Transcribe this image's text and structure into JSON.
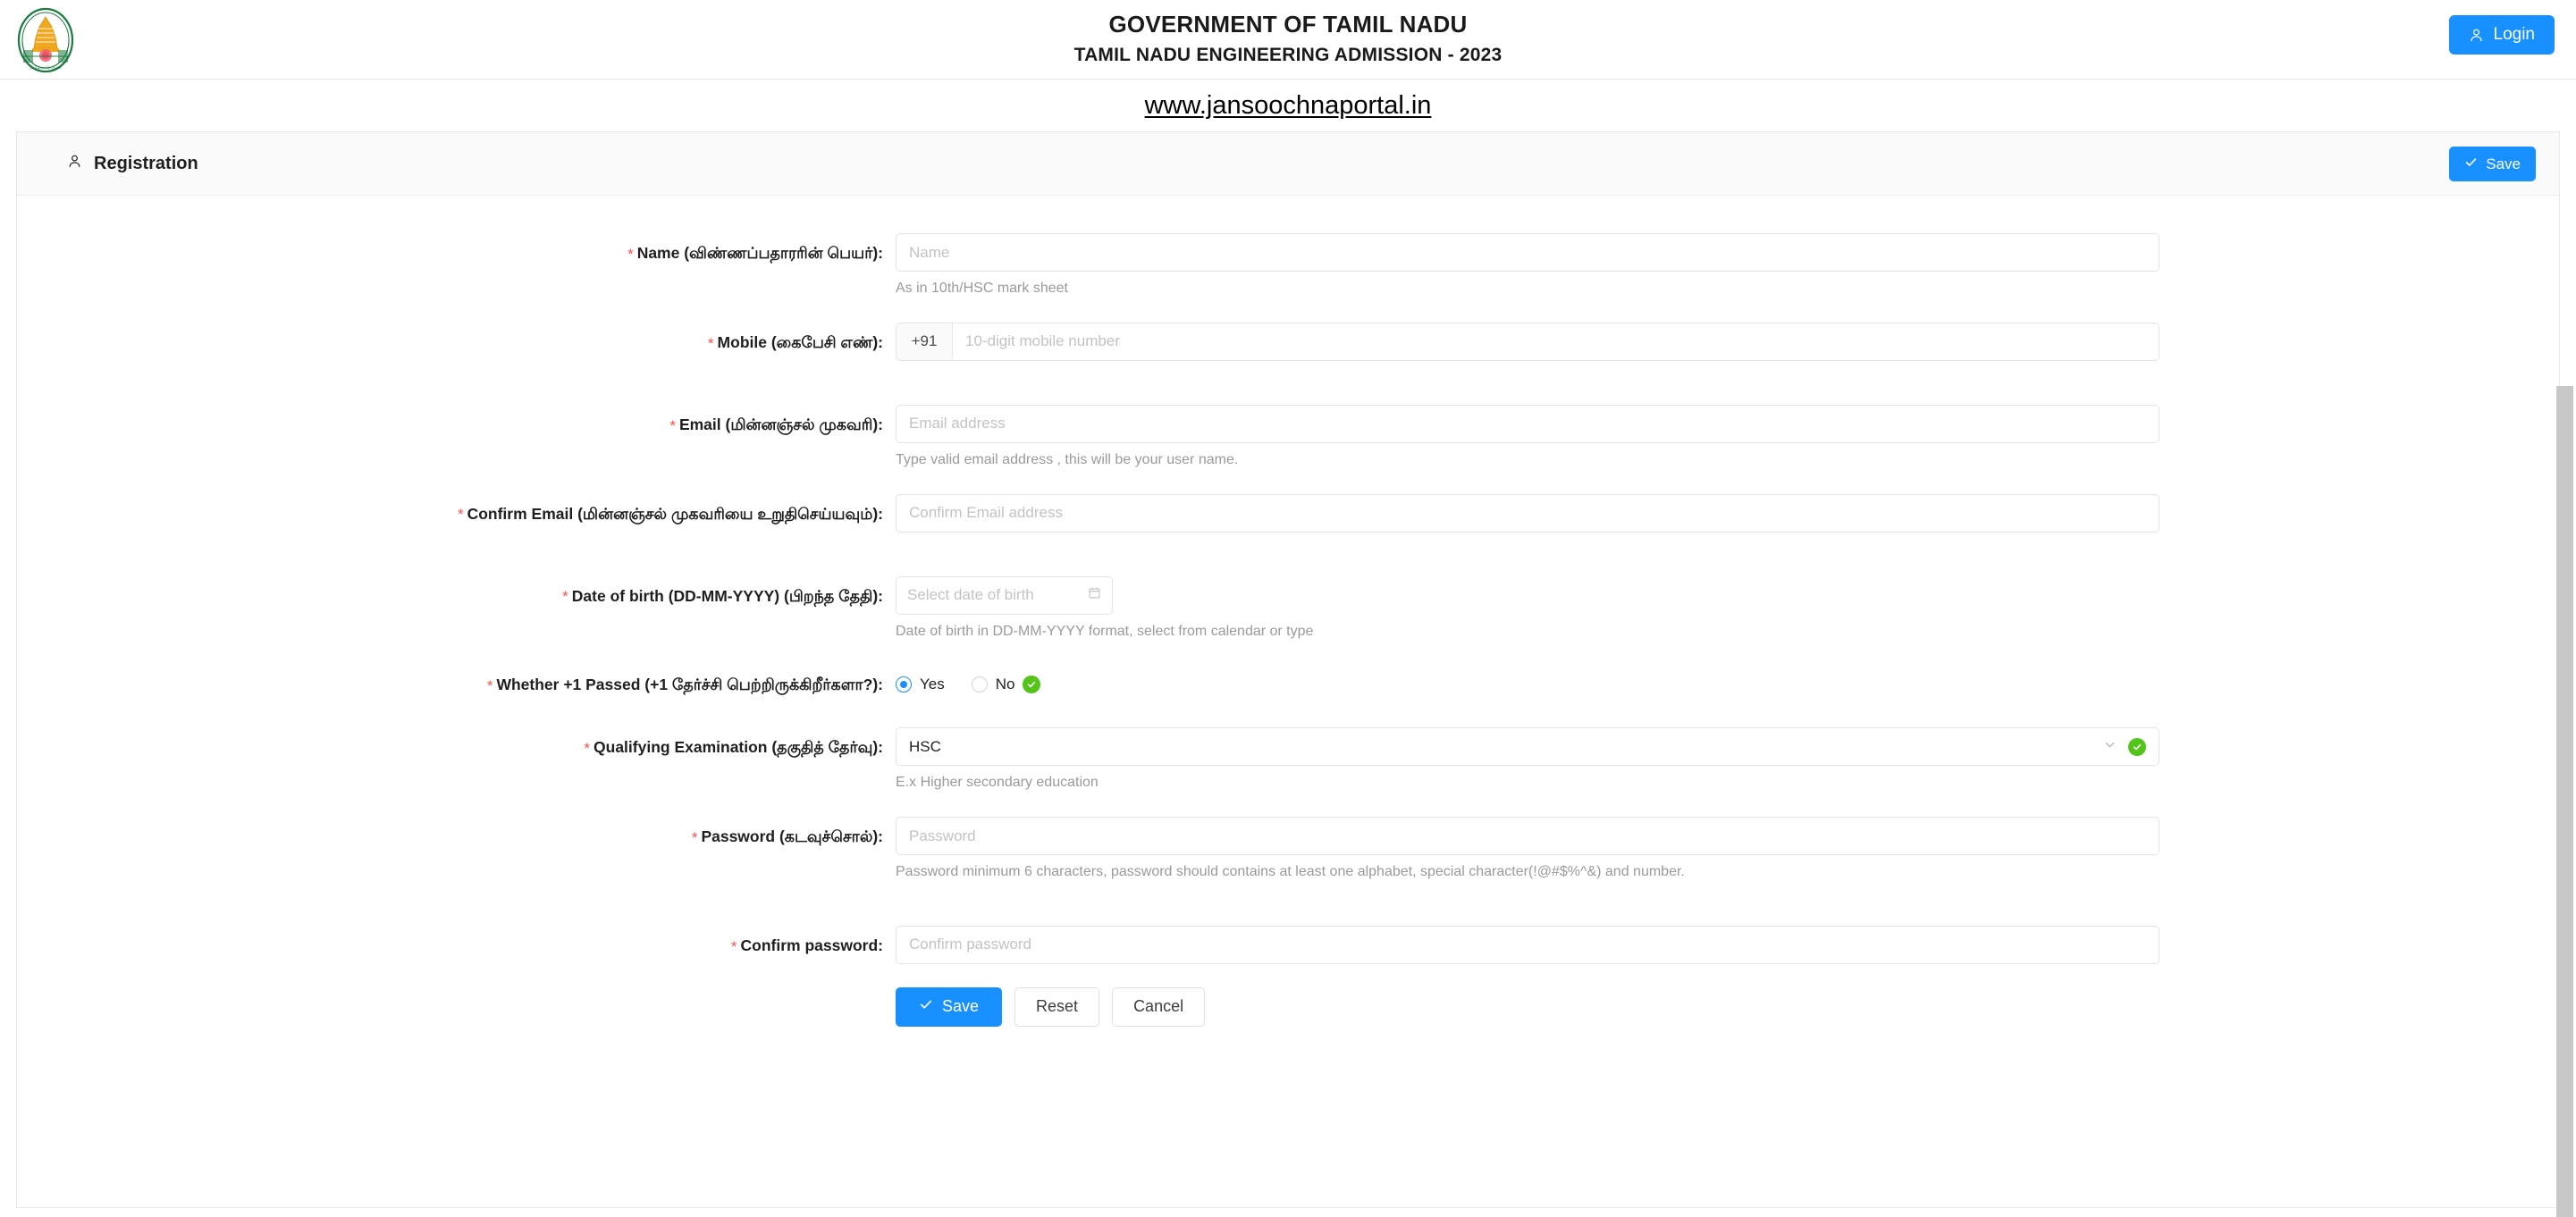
{
  "header": {
    "logo_alt": "Tamil Nadu state emblem",
    "title": "GOVERNMENT OF TAMIL NADU",
    "subtitle": "TAMIL NADU ENGINEERING ADMISSION - 2023",
    "login_label": "Login"
  },
  "url_strip": {
    "link_text": "www.jansoochnaportal.in"
  },
  "card": {
    "title": "Registration",
    "save_label": "Save"
  },
  "form": {
    "name": {
      "label_prefix": "Name (விண்ணப்பதாரரின் பெயர்)",
      "label_suffix": ":",
      "placeholder": "Name",
      "value": "",
      "hint": "As in 10th/HSC mark sheet",
      "required": true
    },
    "mobile": {
      "label_prefix": "Mobile (கைபேசி எண்)",
      "label_suffix": ":",
      "country_code": "+91",
      "placeholder": "10-digit mobile number",
      "value": "",
      "required": true
    },
    "email": {
      "label_prefix": "Email (மின்னஞ்சல் முகவரி)",
      "label_suffix": ":",
      "placeholder": "Email address",
      "value": "",
      "hint": "Type valid email address , this will be your user name.",
      "required": true
    },
    "confirm_email": {
      "label_prefix": "Confirm Email (மின்னஞ்சல் முகவரியை உறுதிசெய்யவும்)",
      "label_suffix": ":",
      "placeholder": "Confirm Email address",
      "value": "",
      "required": true
    },
    "dob": {
      "label_prefix": "Date of birth (DD-MM-YYYY) (பிறந்த தேதி)",
      "label_suffix": ":",
      "placeholder": "Select date of birth",
      "value": "",
      "hint": "Date of birth in DD-MM-YYYY format, select from calendar or type",
      "required": true
    },
    "plus_one_passed": {
      "label_prefix": "Whether +1 Passed (+1 தேர்ச்சி பெற்றிருக்கிறீர்களா?)",
      "label_suffix": ":",
      "options": [
        "Yes",
        "No"
      ],
      "selected": "Yes",
      "required": true,
      "validated": true
    },
    "qualifying_exam": {
      "label_prefix": "Qualifying Examination (தகுதித் தேர்வு)",
      "label_suffix": ":",
      "value": "HSC",
      "hint": "E.x Higher secondary education",
      "required": true,
      "validated": true
    },
    "password": {
      "label_prefix": "Password (கடவுச்சொல்)",
      "label_suffix": ":",
      "placeholder": "Password",
      "value": "",
      "hint": "Password minimum 6 characters, password should contains at least one alphabet, special character(!@#$%^&) and number.",
      "required": true
    },
    "confirm_password": {
      "label_prefix": "Confirm password",
      "label_suffix": ":",
      "placeholder": "Confirm password",
      "value": "",
      "required": true
    }
  },
  "actions": {
    "save_label": "Save",
    "reset_label": "Reset",
    "cancel_label": "Cancel"
  },
  "colors": {
    "primary": "#1890ff",
    "success": "#52c41a",
    "required_star": "#ff4d4f"
  }
}
